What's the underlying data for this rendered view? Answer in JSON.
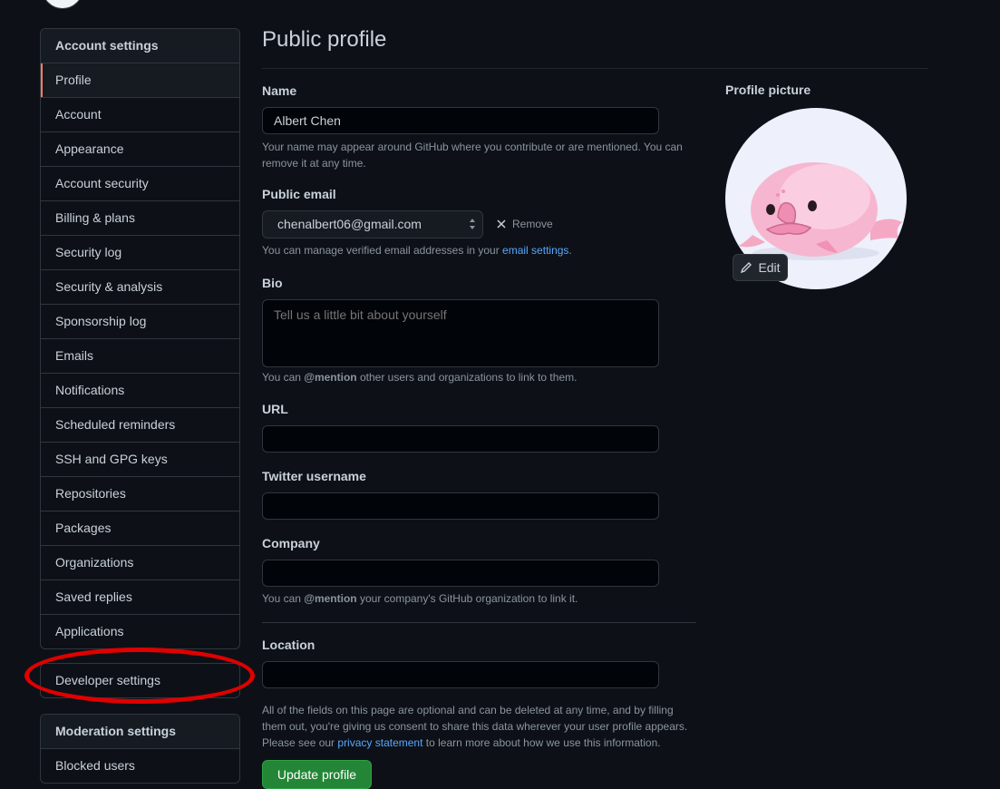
{
  "sidebar": {
    "account_heading": "Account settings",
    "account_items": [
      {
        "label": "Profile",
        "selected": true
      },
      {
        "label": "Account"
      },
      {
        "label": "Appearance"
      },
      {
        "label": "Account security"
      },
      {
        "label": "Billing & plans"
      },
      {
        "label": "Security log"
      },
      {
        "label": "Security & analysis"
      },
      {
        "label": "Sponsorship log"
      },
      {
        "label": "Emails"
      },
      {
        "label": "Notifications"
      },
      {
        "label": "Scheduled reminders"
      },
      {
        "label": "SSH and GPG keys"
      },
      {
        "label": "Repositories"
      },
      {
        "label": "Packages"
      },
      {
        "label": "Organizations"
      },
      {
        "label": "Saved replies"
      },
      {
        "label": "Applications"
      }
    ],
    "developer_item": "Developer settings",
    "moderation_heading": "Moderation settings",
    "moderation_items": [
      {
        "label": "Blocked users"
      }
    ]
  },
  "main": {
    "title": "Public profile",
    "name": {
      "label": "Name",
      "value": "Albert Chen",
      "note": "Your name may appear around GitHub where you contribute or are mentioned. You can remove it at any time."
    },
    "email": {
      "label": "Public email",
      "value": "chenalbert06@gmail.com",
      "remove_label": "Remove",
      "note_prefix": "You can manage verified email addresses in your ",
      "note_link": "email settings",
      "note_suffix": "."
    },
    "bio": {
      "label": "Bio",
      "placeholder": "Tell us a little bit about yourself",
      "note_prefix": "You can ",
      "note_bold": "@mention",
      "note_suffix": " other users and organizations to link to them."
    },
    "url": {
      "label": "URL",
      "value": ""
    },
    "twitter": {
      "label": "Twitter username",
      "value": ""
    },
    "company": {
      "label": "Company",
      "value": "",
      "note_prefix": "You can ",
      "note_bold": "@mention",
      "note_suffix": " your company's GitHub organization to link it."
    },
    "location": {
      "label": "Location",
      "value": ""
    },
    "footer_note_1": "All of the fields on this page are optional and can be deleted at any time, and by filling them out, you're giving us consent to share this data wherever your user profile appears.",
    "footer_note_prefix": "Please see our ",
    "footer_note_link": "privacy statement",
    "footer_note_suffix": " to learn more about how we use this information.",
    "update_button": "Update profile"
  },
  "profile_picture": {
    "label": "Profile picture",
    "edit_label": "Edit"
  },
  "colors": {
    "background": "#0d1117",
    "accent_selected": "#f78166",
    "link": "#58a6ff",
    "primary_button": "#238636",
    "highlight_annotation": "#e00000"
  }
}
